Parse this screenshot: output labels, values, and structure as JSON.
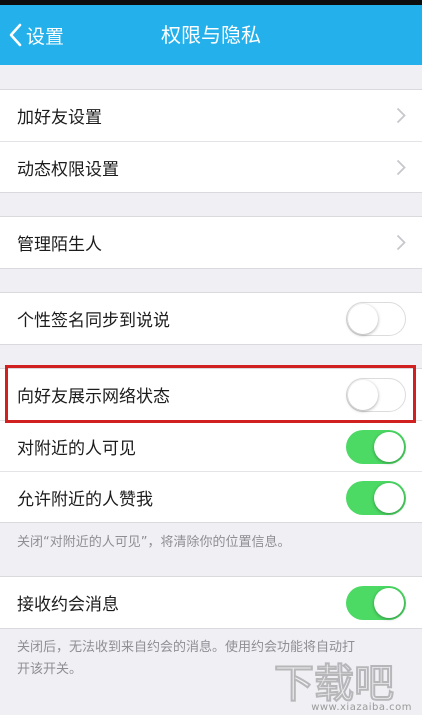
{
  "navbar": {
    "back_label": "设置",
    "title": "权限与隐私"
  },
  "group1": [
    {
      "label": "加好友设置"
    },
    {
      "label": "动态权限设置"
    }
  ],
  "group2": [
    {
      "label": "管理陌生人"
    }
  ],
  "group3": [
    {
      "label": "个性签名同步到说说",
      "on": false
    }
  ],
  "group4": [
    {
      "label": "向好友展示网络状态",
      "on": false
    },
    {
      "label": "对附近的人可见",
      "on": true
    },
    {
      "label": "允许附近的人赞我",
      "on": true
    }
  ],
  "note1": "关闭“对附近的人可见”，将清除你的位置信息。",
  "group5": [
    {
      "label": "接收约会消息",
      "on": true
    }
  ],
  "note2_line1": "关闭后，无法收到来自约会的消息。使用约会功能将自动打",
  "note2_line2": "开该开关。",
  "watermark": {
    "logo_text": "下载吧",
    "url": "www.xiazaiba.com"
  },
  "colors": {
    "navbar": "#24b0ea",
    "toggle_on": "#4cd964",
    "highlight": "#d0201f",
    "background": "#efeff4"
  }
}
